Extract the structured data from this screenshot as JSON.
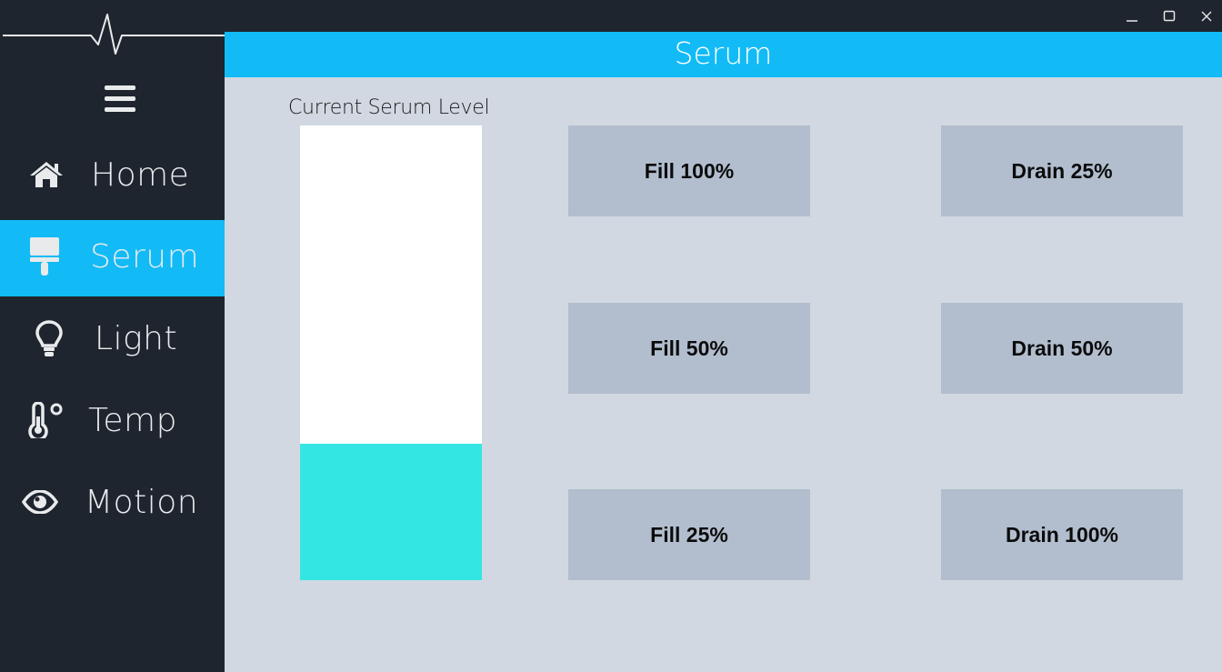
{
  "window": {
    "controls": [
      "minimize-icon",
      "maximize-icon",
      "close-icon"
    ]
  },
  "sidebar": {
    "logo_icon": "heartbeat-line-icon",
    "menu_icon": "hamburger-menu-icon",
    "items": [
      {
        "label": "Home",
        "icon": "home-icon",
        "active": false
      },
      {
        "label": "Serum",
        "icon": "paint-roller-icon",
        "active": true
      },
      {
        "label": "Light",
        "icon": "lightbulb-icon",
        "active": false
      },
      {
        "label": "Temp",
        "icon": "thermometer-icon",
        "active": false
      },
      {
        "label": "Motion",
        "icon": "eye-icon",
        "active": false
      }
    ]
  },
  "header": {
    "title": "Serum"
  },
  "serum": {
    "level_label": "Current Serum Level",
    "level_fraction": 0.3,
    "buttons": {
      "fill_100": "Fill 100%",
      "fill_50": "Fill 50%",
      "fill_25": "Fill 25%",
      "drain_25": "Drain 25%",
      "drain_50": "Drain 50%",
      "drain_100": "Drain 100%"
    }
  },
  "colors": {
    "sidebar_bg": "#1e252e",
    "accent": "#12bbf6",
    "content_bg": "#d1d8e1",
    "button_bg": "#b2bece",
    "serum_fill": "#33e6e3",
    "tank_bg": "#ffffff"
  }
}
